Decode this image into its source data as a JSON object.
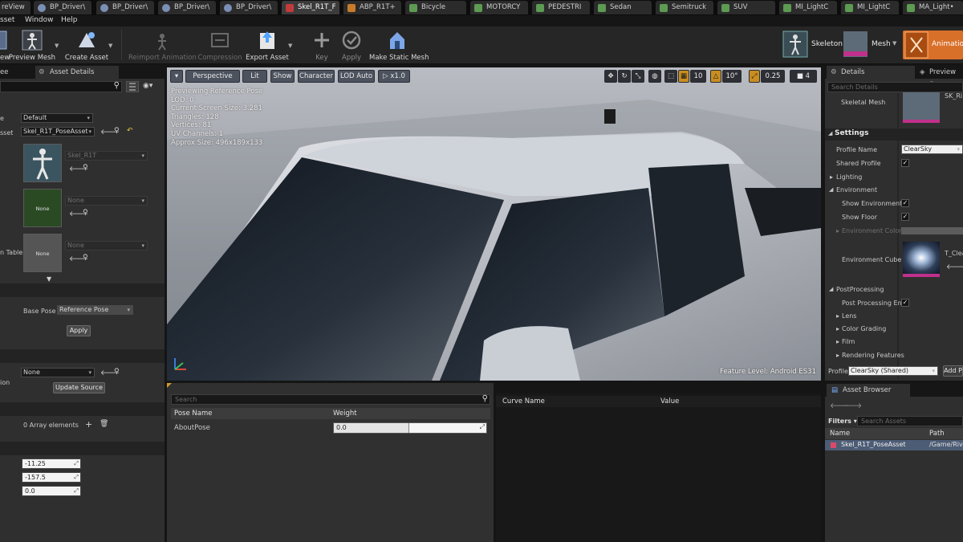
{
  "tabs": [
    {
      "label": "reView",
      "icon": "blueprint-icon"
    },
    {
      "label": "BP_Driver\\",
      "icon": "blueprint-icon"
    },
    {
      "label": "BP_Driver\\",
      "icon": "blueprint-icon"
    },
    {
      "label": "BP_Driver\\",
      "icon": "blueprint-icon"
    },
    {
      "label": "BP_Driver\\",
      "icon": "blueprint-icon"
    },
    {
      "label": "Skel_R1T_F",
      "icon": "pose-asset-icon"
    },
    {
      "label": "ABP_R1T+",
      "icon": "anim-blueprint-icon"
    },
    {
      "label": "Bicycle",
      "icon": "folder-icon"
    },
    {
      "label": "MOTORCY",
      "icon": "folder-icon"
    },
    {
      "label": "PEDESTRI",
      "icon": "folder-icon"
    },
    {
      "label": "Sedan",
      "icon": "folder-icon"
    },
    {
      "label": "Semitruck",
      "icon": "folder-icon"
    },
    {
      "label": "SUV",
      "icon": "folder-icon"
    },
    {
      "label": "MI_LightC",
      "icon": "material-icon"
    },
    {
      "label": "MI_LightC",
      "icon": "material-icon"
    },
    {
      "label": "MA_Light•",
      "icon": "material-icon"
    }
  ],
  "menu": [
    "sset",
    "Window",
    "Help"
  ],
  "toolbar": {
    "preview_label": "ew",
    "preview_mesh": "Preview Mesh",
    "create_asset": "Create Asset",
    "reimport": "Reimport Animation",
    "compression": "Compression",
    "export_asset": "Export Asset",
    "key": "Key",
    "apply": "Apply",
    "make_static": "Make Static Mesh",
    "skeleton": "Skeleton",
    "mesh": "Mesh",
    "animation": "Animation"
  },
  "left": {
    "tab1": "ee",
    "tab2": "Asset Details",
    "row1_label": "e",
    "row1_value": "Default",
    "row2_label": "sset",
    "row2_value": "Skel_R1T_PoseAsset",
    "thumb1_value": "Skel_R1T",
    "thumb2_caption": "None",
    "thumb2_value": "None",
    "thumb3_caption": "None",
    "thumb3_value": "None",
    "thumb3_label": "n Table",
    "base_pose_label": "Base Pose",
    "base_pose_value": "Reference Pose",
    "apply_btn": "Apply",
    "source_label": "ion",
    "source_value": "None",
    "update_source": "Update Source",
    "array_elements": "0 Array elements",
    "num1": "-11.25",
    "num2": "-157.5",
    "num3": "0.0"
  },
  "viewport": {
    "perspective": "Perspective",
    "lit": "Lit",
    "show": "Show",
    "character": "Character",
    "lod": "LOD Auto",
    "speed": "x1.0",
    "grid_val": "10",
    "angle_val": "10°",
    "scale_val": "0.25",
    "cam_val": "4",
    "stats": [
      "Previewing Reference Pose",
      "LOD: 0",
      "Current Screen Size: 3.281",
      "Triangles: 128",
      "Vertices: 81",
      "UV Channels: 1",
      "Approx Size: 496x189x133"
    ],
    "feature_level": "Feature Level:  Android ES31"
  },
  "pose": {
    "search_placeholder": "Search",
    "col1": "Pose Name",
    "col2": "Weight",
    "row_name": "AboutPose",
    "row_weight": "0.0"
  },
  "curves": {
    "col1": "Curve Name",
    "col2": "Value"
  },
  "right": {
    "tab1": "Details",
    "tab2": "Preview Sc",
    "search_placeholder": "Search Details",
    "skeletal_mesh": "Skeletal Mesh",
    "mesh_thumb": "SK_Ri",
    "settings": "Settings",
    "profile_name": "Profile Name",
    "profile_value": "ClearSky",
    "shared_profile": "Shared Profile",
    "lighting": "Lighting",
    "environment": "Environment",
    "show_env": "Show Environment",
    "show_floor": "Show Floor",
    "env_color": "Environment Color",
    "env_cube": "Environment Cube M",
    "env_cube_val": "T_Clea",
    "postprocessing": "PostProcessing",
    "pp_enabled": "Post Processing Ena",
    "lens": "Lens",
    "color_grading": "Color Grading",
    "film": "Film",
    "rendering": "Rendering Features",
    "profile_label": "Profile",
    "profile_combo": "ClearSky (Shared)",
    "add_profile": "Add P"
  },
  "browser": {
    "tab": "Asset Browser",
    "filters": "Filters",
    "search_placeholder": "Search Assets",
    "col_name": "Name",
    "col_path": "Path",
    "asset_name": "Skel_R1T_PoseAsset",
    "asset_path": "/Game/Riv"
  }
}
